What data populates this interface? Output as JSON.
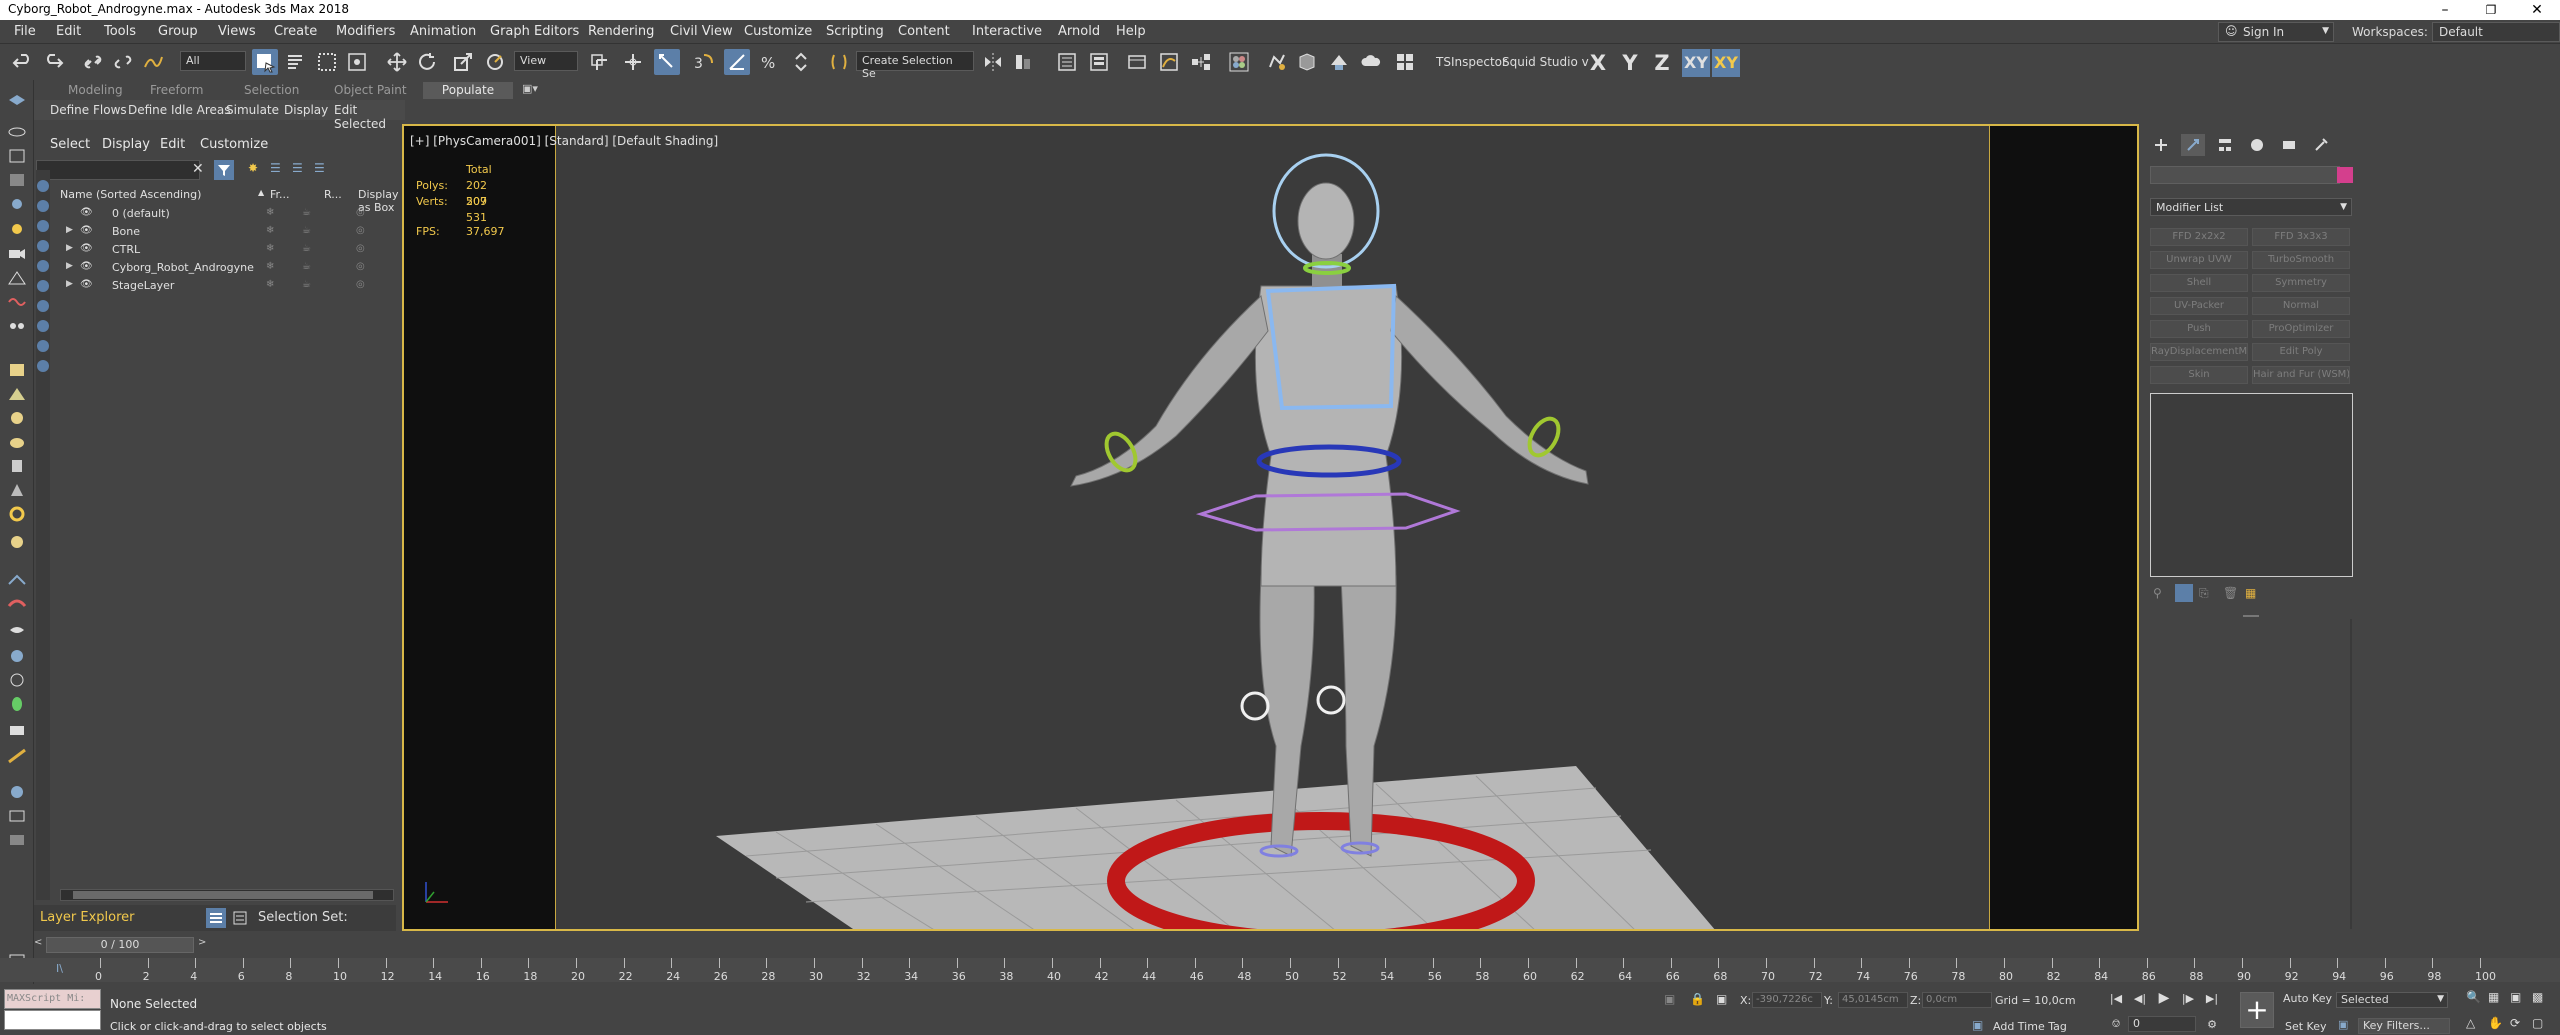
{
  "window": {
    "title": "Cyborg_Robot_Androgyne.max - Autodesk 3ds Max 2018",
    "minimize_glyph": "–",
    "restore_glyph": "❐",
    "close_glyph": "✕"
  },
  "menu": [
    "File",
    "Edit",
    "Tools",
    "Group",
    "Views",
    "Create",
    "Modifiers",
    "Animation",
    "Graph Editors",
    "Rendering",
    "Civil View",
    "Customize",
    "Scripting",
    "Content",
    "Interactive",
    "Arnold",
    "Help"
  ],
  "account": {
    "signin": "Sign In",
    "workspaces_label": "Workspaces:",
    "workspace": "Default"
  },
  "toolbar": {
    "selection_filter": "All",
    "ref_coord": "View",
    "named_selection": "Create Selection Se",
    "tsinspector": "TSInspector",
    "squid": "Squid Studio v",
    "axes": [
      "X",
      "Y",
      "Z",
      "XY",
      "XY"
    ]
  },
  "ribbon": {
    "tabs": [
      "Modeling",
      "Freeform",
      "Selection",
      "Object Paint"
    ],
    "populate": "Populate",
    "subtabs": [
      "Define Flows",
      "Define Idle Areas",
      "Simulate",
      "Display",
      "Edit Selected"
    ]
  },
  "explorer": {
    "tabs": [
      "Select",
      "Display",
      "Edit",
      "Customize"
    ],
    "columns": {
      "name": "Name (Sorted Ascending)",
      "freeze": "Fr...",
      "render": "R...",
      "box": "Display as Box"
    },
    "rows": [
      {
        "name": "0 (default)",
        "expand": ""
      },
      {
        "name": "Bone",
        "expand": "▶"
      },
      {
        "name": "CTRL",
        "expand": "▶"
      },
      {
        "name": "Cyborg_Robot_Androgyne",
        "expand": "▶"
      },
      {
        "name": "StageLayer",
        "expand": "▶"
      }
    ],
    "layer_explorer": "Layer Explorer",
    "selection_set": "Selection Set:"
  },
  "viewport": {
    "label": "[+] [PhysCamera001] [Standard] [Default Shading]",
    "stats": {
      "total": "Total",
      "polys_label": "Polys:",
      "polys": "202 509",
      "verts_label": "Verts:",
      "verts": "207 531",
      "fps_label": "FPS:",
      "fps": "37,697"
    }
  },
  "command_panel": {
    "modifier_list": "Modifier List",
    "modifiers": [
      "FFD 2x2x2",
      "FFD 3x3x3",
      "Unwrap UVW",
      "TurboSmooth",
      "Shell",
      "Symmetry",
      "UV-Packer",
      "Normal",
      "Push",
      "ProOptimizer",
      "RayDisplacementMo",
      "Edit Poly",
      "Skin",
      "Hair and Fur (WSM)"
    ],
    "object_color": "#d43f8d"
  },
  "timeline": {
    "slider": "0 / 100",
    "ticks": [
      0,
      2,
      4,
      6,
      8,
      10,
      12,
      14,
      16,
      18,
      20,
      22,
      24,
      26,
      28,
      30,
      32,
      34,
      36,
      38,
      40,
      42,
      44,
      46,
      48,
      50,
      52,
      54,
      56,
      58,
      60,
      62,
      64,
      66,
      68,
      70,
      72,
      74,
      76,
      78,
      80,
      82,
      84,
      86,
      88,
      90,
      92,
      94,
      96,
      98,
      100
    ]
  },
  "status": {
    "maxscript": "MAXScript Mi:",
    "selection": "None Selected",
    "prompt": "Click or click-and-drag to select objects",
    "x_label": "X:",
    "x": "-390,7226c",
    "y_label": "Y:",
    "y": "45,0145cm",
    "z_label": "Z:",
    "z": "0,0cm",
    "grid": "Grid = 10,0cm",
    "add_time_tag": "Add Time Tag",
    "frame": "0",
    "auto_key": "Auto Key",
    "set_key": "Set Key",
    "selected": "Selected",
    "key_filters": "Key Filters..."
  }
}
